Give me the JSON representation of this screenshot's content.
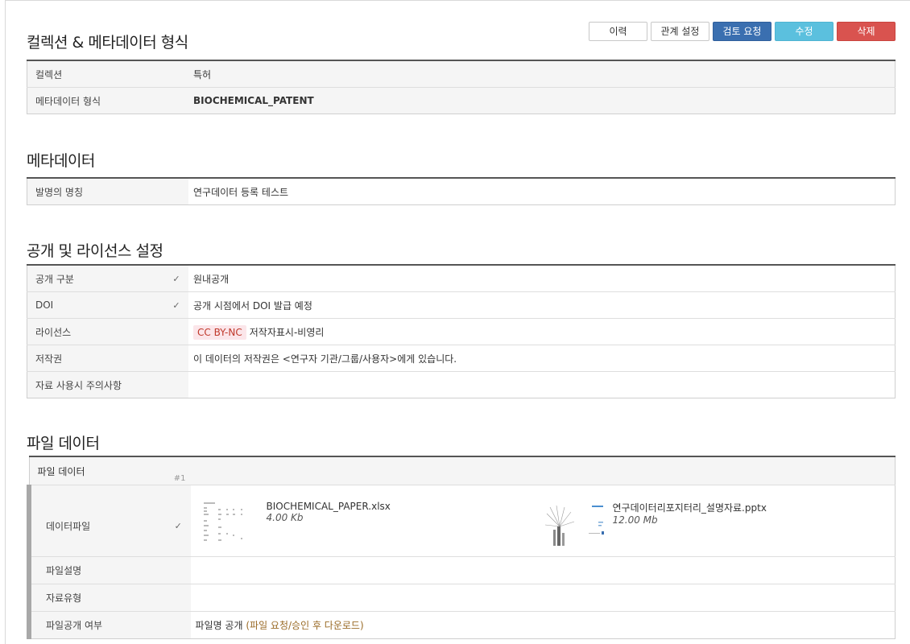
{
  "toolbar": {
    "history": "이력",
    "relation": "관계 설정",
    "review": "검토 요청",
    "edit": "수정",
    "delete": "삭제"
  },
  "collection": {
    "title": "컬렉션 & 메타데이터 형식",
    "rows": [
      {
        "label": "컬렉션",
        "value": "특허"
      },
      {
        "label": "메타데이터 형식",
        "value": "BIOCHEMICAL_PATENT"
      }
    ]
  },
  "metadata": {
    "title": "메타데이터",
    "rows": [
      {
        "label": "발명의 명칭",
        "value": "연구데이터 등록 테스트"
      }
    ]
  },
  "license": {
    "title": "공개 및 라이선스 설정",
    "open_type": {
      "label": "공개 구분",
      "value": "원내공개"
    },
    "doi": {
      "label": "DOI",
      "value": "공개 시점에서 DOI 발급 예정"
    },
    "license": {
      "label": "라이선스",
      "badge": "CC BY-NC",
      "value": "저작자표시-비영리"
    },
    "copyright": {
      "label": "저작권",
      "value": "이 데이터의 저작권은 <연구자 기관/그룹/사용자>에게 있습니다."
    },
    "caution": {
      "label": "자료 사용시 주의사항",
      "value": ""
    }
  },
  "file_data": {
    "title": "파일 데이터",
    "header_label": "파일 데이터",
    "header_index": "#1",
    "data_file_label": "데이터파일",
    "files": [
      {
        "name": "BIOCHEMICAL_PAPER.xlsx",
        "size": "4.00 Kb",
        "icon": "spreadsheet-thumbnail"
      },
      {
        "name": "연구데이터리포지터리_설명자료.pptx",
        "size": "12.00 Mb",
        "icon": "presentation-thumbnail"
      }
    ],
    "description_label": "파일설명",
    "description_value": "",
    "type_label": "자료유형",
    "type_value": "",
    "public_label": "파일공개 여부",
    "public_value": "파일명 공개",
    "public_note": "(파일 요청/승인 후 다운로드)"
  }
}
